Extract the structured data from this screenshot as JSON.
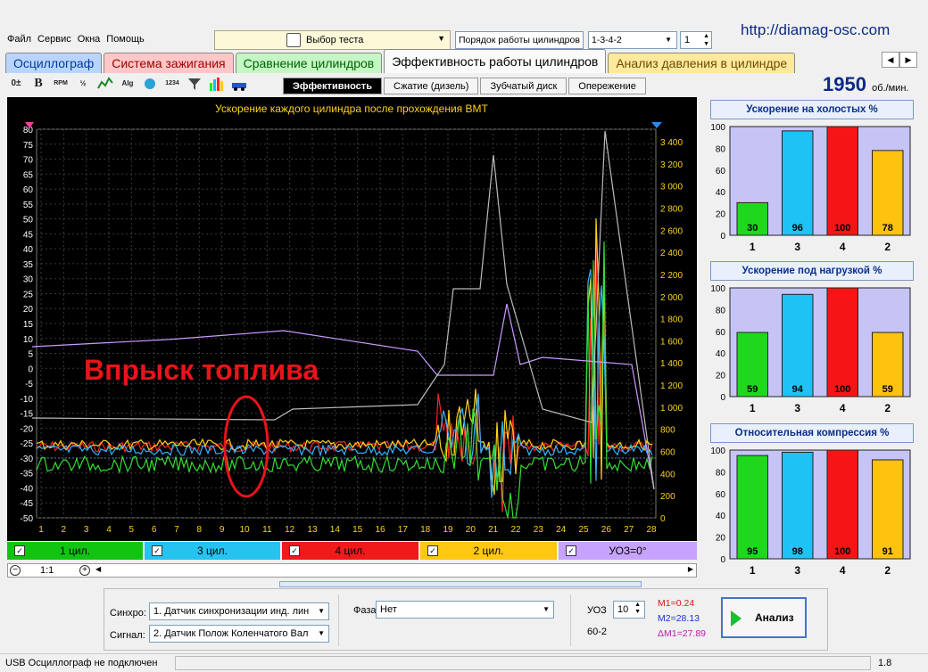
{
  "menu": [
    "Файл",
    "Сервис",
    "Окна",
    "Помощь"
  ],
  "site": "http://diamag-osc.com",
  "test_select": "Выбор теста",
  "order_label": "Порядок работы цилиндров",
  "order_value": "1-3-4-2",
  "spin_value": "1",
  "tabs": [
    "Осциллограф",
    "Система зажигания",
    "Сравнение цилиндров",
    "Эффективность работы цилиндров",
    "Анализ давления в цилиндре"
  ],
  "toolbar_icons": [
    "0±-icon",
    "bold-b-icon",
    "rpm-icon",
    "ratio-icon",
    "wave-icon",
    "alg-icon",
    "engine-icon",
    "sort-1234-icon",
    "filter-icon",
    "bars-icon",
    "car-icon"
  ],
  "subtabs": [
    "Эффективность",
    "Сжатие (дизель)",
    "Зубчатый диск",
    "Опережение"
  ],
  "rpm": {
    "value": "1950",
    "unit": "об./мин."
  },
  "chart_title": "Ускорение каждого цилиндра после прохождения ВМТ",
  "overlay_text": "Впрыск топлива",
  "left_axis": [
    "80",
    "75",
    "70",
    "65",
    "60",
    "55",
    "50",
    "45",
    "40",
    "35",
    "30",
    "25",
    "20",
    "15",
    "10",
    "5",
    "0",
    "-5",
    "-10",
    "-15",
    "-20",
    "-25",
    "-30",
    "-35",
    "-40",
    "-45",
    "-50"
  ],
  "right_axis": [
    "3 400",
    "3 200",
    "3 000",
    "2 800",
    "2 600",
    "2 400",
    "2 200",
    "2 000",
    "1 800",
    "1 600",
    "1 400",
    "1 200",
    "1 000",
    "800",
    "600",
    "400",
    "200",
    "0"
  ],
  "x_axis": [
    "1",
    "2",
    "3",
    "4",
    "5",
    "6",
    "7",
    "8",
    "9",
    "10",
    "11",
    "12",
    "13",
    "14",
    "15",
    "16",
    "17",
    "18",
    "19",
    "20",
    "21",
    "22",
    "23",
    "24",
    "25",
    "26",
    "27",
    "28"
  ],
  "colors": {
    "c1": "#33dd33",
    "c3": "#33b5ff",
    "c4": "#ff2222",
    "c2": "#ffd21a",
    "uoz": "#c99cff"
  },
  "channels": [
    {
      "label": "1 цил.",
      "color": "#12c412"
    },
    {
      "label": "3 цил.",
      "color": "#26c2f0"
    },
    {
      "label": "4 цил.",
      "color": "#f01a1a"
    },
    {
      "label": "2 цил.",
      "color": "#ffc712"
    },
    {
      "label": "УОЗ=0°",
      "color": "#c7a3ff"
    }
  ],
  "zoom": "1:1",
  "panels": [
    {
      "title": "Ускорение на холостых %",
      "values": [
        30,
        96,
        100,
        78
      ]
    },
    {
      "title": "Ускорение под нагрузкой %",
      "values": [
        59,
        94,
        100,
        59
      ]
    },
    {
      "title": "Относительная компрессия %",
      "values": [
        95,
        98,
        100,
        91
      ]
    }
  ],
  "bar_labels": [
    "1",
    "3",
    "4",
    "2"
  ],
  "bar_colors": [
    "#1ed81e",
    "#1ec2f5",
    "#f51515",
    "#ffc20f"
  ],
  "bar_axis": [
    "100",
    "80",
    "60",
    "40",
    "20",
    "0"
  ],
  "bottom": {
    "sync_label": "Синхро:",
    "sync_value": "1. Датчик синхронизации инд. лин",
    "signal_label": "Сигнал:",
    "signal_value": "2. Датчик Полож Коленчатого Вал",
    "phase_label": "Фаза",
    "phase_value": "Нет",
    "uoz_label": "УОЗ",
    "uoz_value": "10",
    "teeth": "60-2",
    "m1": "M1=0.24",
    "m2": "M2=28.13",
    "dm1": "ΔM1=27.89",
    "analyze": "Анализ"
  },
  "status": {
    "left": "USB Осциллограф не подключен",
    "right": "1.8"
  }
}
